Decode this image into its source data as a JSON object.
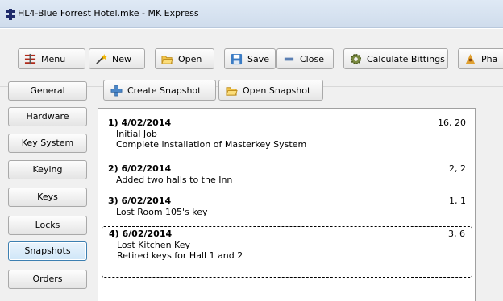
{
  "window": {
    "title": "HL4-Blue Forrest Hotel.mke - MK Express"
  },
  "toolbar": {
    "menu_label": "Menu",
    "new_label": "New",
    "open_label": "Open",
    "save_label": "Save",
    "close_label": "Close",
    "calculate_label": "Calculate Bittings",
    "pha_label": "Pha"
  },
  "sidebar": {
    "items": [
      {
        "label": "General"
      },
      {
        "label": "Hardware"
      },
      {
        "label": "Key System"
      },
      {
        "label": "Keying"
      },
      {
        "label": "Keys"
      },
      {
        "label": "Locks"
      },
      {
        "label": "Snapshots"
      },
      {
        "label": "Orders"
      }
    ],
    "active": "Snapshots"
  },
  "snapshots": {
    "create_label": "Create Snapshot",
    "open_label": "Open Snapshot",
    "items": [
      {
        "header": "1) 4/02/2014",
        "count": "16, 20",
        "lines": [
          "Initial Job",
          "Complete installation of Masterkey System"
        ]
      },
      {
        "header": "2) 6/02/2014",
        "count": "2, 2",
        "lines": [
          "Added two halls to the Inn"
        ]
      },
      {
        "header": "3) 6/02/2014",
        "count": "1, 1",
        "lines": [
          "Lost Room 105's key"
        ]
      },
      {
        "header": "4) 6/02/2014",
        "count": "3, 6",
        "lines": [
          "Lost Kitchen Key",
          "Retired keys for Hall 1 and 2"
        ]
      }
    ]
  }
}
